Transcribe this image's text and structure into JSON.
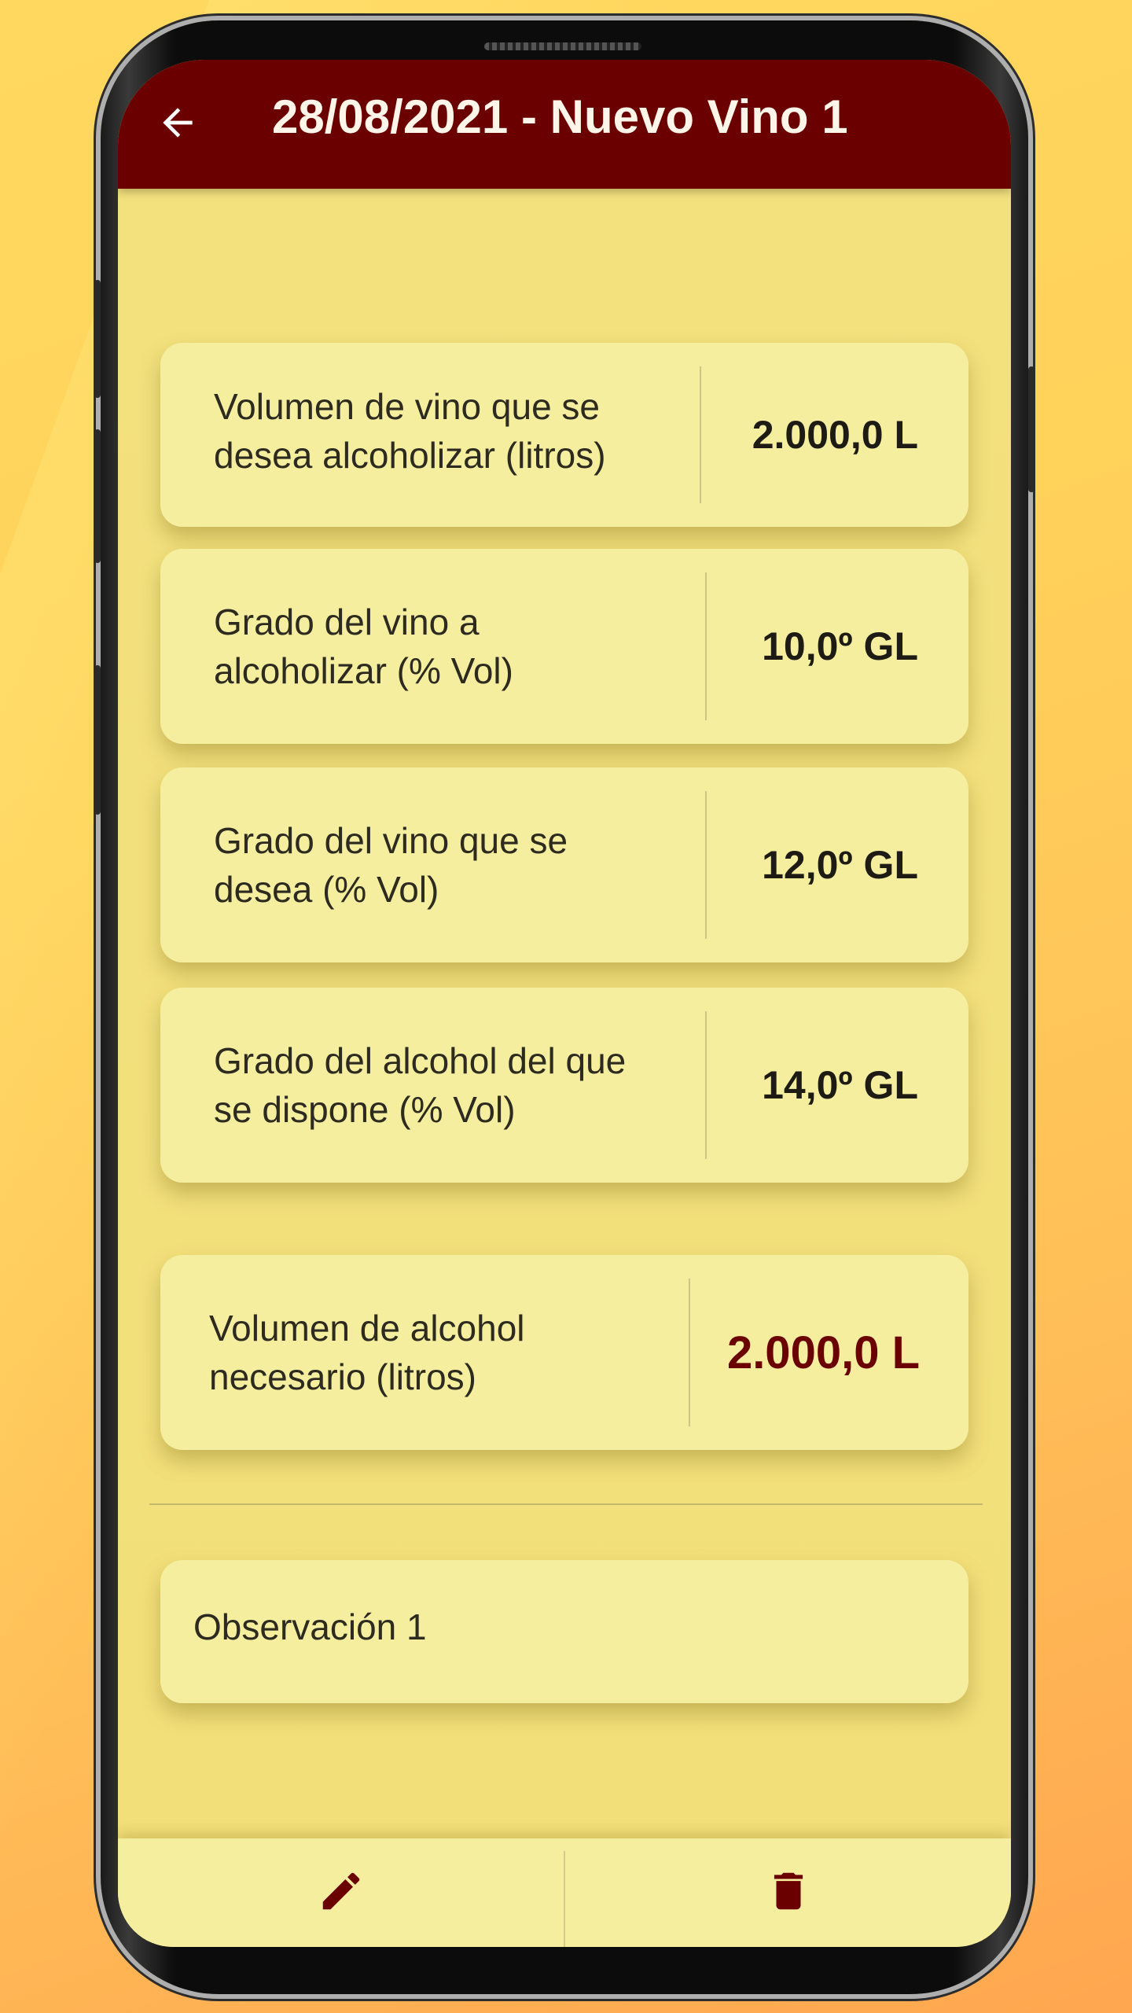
{
  "colors": {
    "appbar": "#6b0000",
    "card": "#f5ee9f",
    "screen_bg": "#f3e17e",
    "result_value": "#6b0000",
    "icon": "#6b0000"
  },
  "appbar": {
    "title": "28/08/2021 - Nuevo Vino 1",
    "back_icon": "arrow-left-icon"
  },
  "inputs": [
    {
      "label_line1": "Volumen de vino que se",
      "label_line2": "desea alcoholizar (litros)",
      "value": "2.000,0 L"
    },
    {
      "label_line1": "Grado del vino a",
      "label_line2": "alcoholizar (% Vol)",
      "value": "10,0º GL"
    },
    {
      "label_line1": "Grado del vino que se",
      "label_line2": "desea (% Vol)",
      "value": "12,0º GL"
    },
    {
      "label_line1": "Grado del alcohol del que",
      "label_line2": "se dispone (% Vol)",
      "value": "14,0º GL"
    }
  ],
  "result": {
    "label_line1": "Volumen de alcohol",
    "label_line2": "necesario (litros)",
    "value": "2.000,0 L"
  },
  "observation": {
    "text": "Observación 1"
  },
  "bottom_bar": {
    "edit_icon": "pencil-icon",
    "delete_icon": "trash-icon"
  }
}
